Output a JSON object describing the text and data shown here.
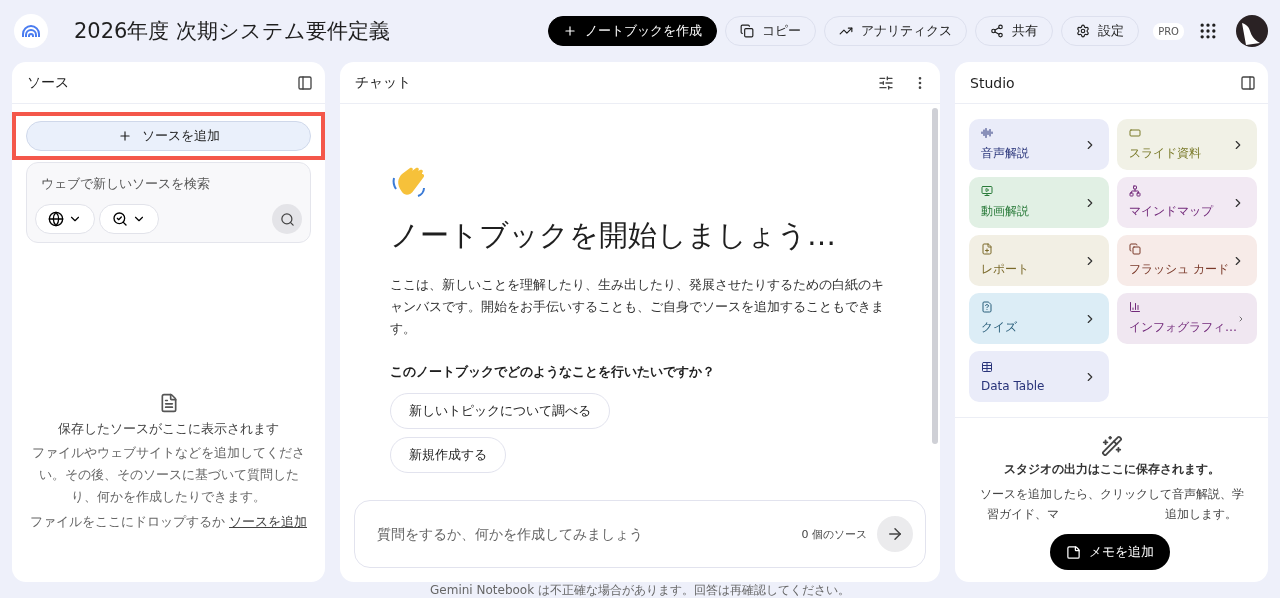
{
  "header": {
    "title": "2026年度 次期システム要件定義",
    "actions": [
      {
        "kind": "primary",
        "label": "ノートブックを作成"
      },
      {
        "kind": "outline",
        "label": "コピー"
      },
      {
        "kind": "outline",
        "label": "アナリティクス"
      },
      {
        "kind": "outline",
        "label": "共有"
      },
      {
        "kind": "outline",
        "label": "設定"
      }
    ],
    "badge": "PRO"
  },
  "sources": {
    "title": "ソース",
    "add_button": {
      "label": "ソースを追加",
      "highlighted": true
    },
    "search": {
      "placeholder": "ウェブで新しいソースを検索"
    },
    "empty": {
      "title": "保存したソースがここに表示されます",
      "description": "ファイルやウェブサイトなどを追加してください。その後、そのソースに基づいて質問したり、何かを作成したりできます。",
      "drop_text": "ファイルをここにドロップするか",
      "link": "ソースを追加"
    }
  },
  "chat": {
    "title": "チャット",
    "heading": "ノートブックを開始しましょう…",
    "intro": "ここは、新しいことを理解したり、生み出したり、発展させたりするための白紙のキャンバスです。開始をお手伝いすることも、ご自身でソースを追加することもできます。",
    "question": "このノートブックでどのようなことを行いたいですか？",
    "suggestions": [
      "新しいトピックについて調べる",
      "新規作成する"
    ],
    "input": {
      "placeholder": "質問をするか、何かを作成してみましょう",
      "source_count": "0 個のソース"
    }
  },
  "studio": {
    "title": "Studio",
    "tiles": [
      {
        "label": "音声解説",
        "color": "#eaecf9"
      },
      {
        "label": "スライド資料",
        "color": "#f1f1e6"
      },
      {
        "label": "動画解説",
        "color": "#e1f0e4"
      },
      {
        "label": "マインドマップ",
        "color": "#f2e9f3"
      },
      {
        "label": "レポート",
        "color": "#f2efe4"
      },
      {
        "label": "フラッシュ カード",
        "color": "#f7ebe8"
      },
      {
        "label": "クイズ",
        "color": "#dcedf6"
      },
      {
        "label": "インフォグラフィ…",
        "color": "#f0e7f1"
      },
      {
        "label": "Data Table",
        "color": "#eaecf9"
      }
    ],
    "empty": {
      "title": "スタジオの出力はここに保存されます。",
      "description_parts": [
        "ソースを追加したら、クリックして音声解説、学",
        "習ガイド、マ",
        "追加します。"
      ]
    },
    "note_button": "メモを追加"
  },
  "footer": "Gemini Notebook は不正確な場合があります。回答は再確認してください。"
}
